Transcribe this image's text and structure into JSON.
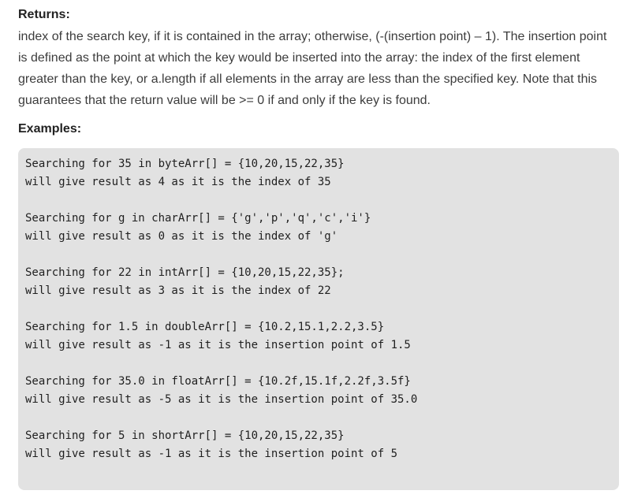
{
  "returns": {
    "heading": "Returns:",
    "text": "index of the search key, if it is contained in the array; otherwise, (-(insertion point) – 1). The insertion point is defined as the point at which the key would be inserted into the array: the index of the first element greater than the key, or a.length if all elements in the array are less than the specified key. Note that this guarantees that the return value will be >= 0 if and only if the key is found."
  },
  "examples": {
    "heading": "Examples:",
    "blocks": [
      {
        "line1": "Searching for 35 in byteArr[] = {10,20,15,22,35}",
        "line2": "will give result as 4 as it is the index of 35"
      },
      {
        "line1": "Searching for g in charArr[] = {'g','p','q','c','i'}",
        "line2": "will give result as 0 as it is the index of 'g'"
      },
      {
        "line1": "Searching for 22 in intArr[] = {10,20,15,22,35};",
        "line2": "will give result as 3 as it is the index of 22"
      },
      {
        "line1": "Searching for 1.5 in doubleArr[] = {10.2,15.1,2.2,3.5}",
        "line2": "will give result as -1 as it is the insertion point of 1.5"
      },
      {
        "line1": "Searching for 35.0 in floatArr[] = {10.2f,15.1f,2.2f,3.5f}",
        "line2": "will give result as -5 as it is the insertion point of 35.0"
      },
      {
        "line1": "Searching for 5 in shortArr[] = {10,20,15,22,35}",
        "line2": "will give result as -1 as it is the insertion point of 5"
      }
    ]
  }
}
